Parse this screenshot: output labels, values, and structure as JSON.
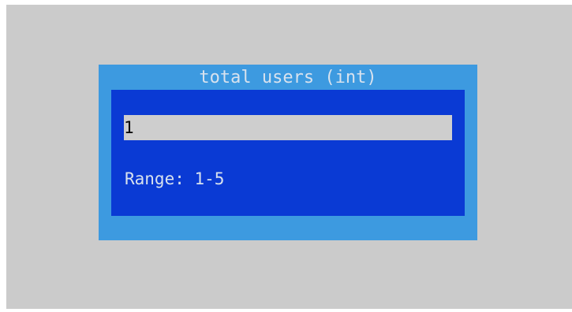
{
  "dialog": {
    "title": "total users (int)",
    "input_value": "1",
    "range_text": "Range: 1-5"
  },
  "colors": {
    "screen_background": "#cbcbcb",
    "dialog_frame": "#3d9ae0",
    "dialog_body": "#0a3ad4",
    "input_background": "#cecece",
    "text": "#d8e2ee"
  }
}
